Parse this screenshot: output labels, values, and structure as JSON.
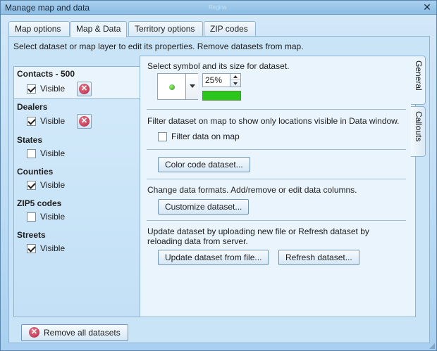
{
  "window": {
    "title": "Manage map and data",
    "background_label": "Regina"
  },
  "tabs": [
    {
      "label": "Map options"
    },
    {
      "label": "Map & Data",
      "active": true
    },
    {
      "label": "Territory options"
    },
    {
      "label": "ZIP codes"
    }
  ],
  "hint": "Select dataset or map layer to edit its properties. Remove datasets from map.",
  "datasets": [
    {
      "name": "Contacts - 500",
      "visible_label": "Visible",
      "checked": true,
      "removable": true,
      "selected": true
    },
    {
      "name": "Dealers",
      "visible_label": "Visible",
      "checked": true,
      "removable": true
    },
    {
      "name": "States",
      "visible_label": "Visible",
      "checked": false
    },
    {
      "name": "Counties",
      "visible_label": "Visible",
      "checked": true
    },
    {
      "name": "ZIP5 codes",
      "visible_label": "Visible",
      "checked": false
    },
    {
      "name": "Streets",
      "visible_label": "Visible",
      "checked": true
    }
  ],
  "general": {
    "symbol_label": "Select symbol and its size for dataset.",
    "size_value": "25%",
    "symbol_color": "#2cc51b",
    "filter_text": "Filter dataset on map to show only locations visible in Data window.",
    "filter_checkbox_label": "Filter data on map",
    "color_code_button": "Color code dataset...",
    "formats_text": "Change data formats. Add/remove or edit data columns.",
    "customize_button": "Customize dataset...",
    "update_text_line1": "Update dataset by uploading new file or Refresh dataset by",
    "update_text_line2": "reloading data from server.",
    "update_button": "Update dataset from file...",
    "refresh_button": "Refresh dataset..."
  },
  "side_tabs": [
    {
      "label": "General",
      "active": true
    },
    {
      "label": "Callouts"
    }
  ],
  "remove_all_label": "Remove all datasets",
  "icons": {
    "close": "close-icon",
    "remove": "remove-circle-icon",
    "symbol": "green-dot-icon"
  }
}
